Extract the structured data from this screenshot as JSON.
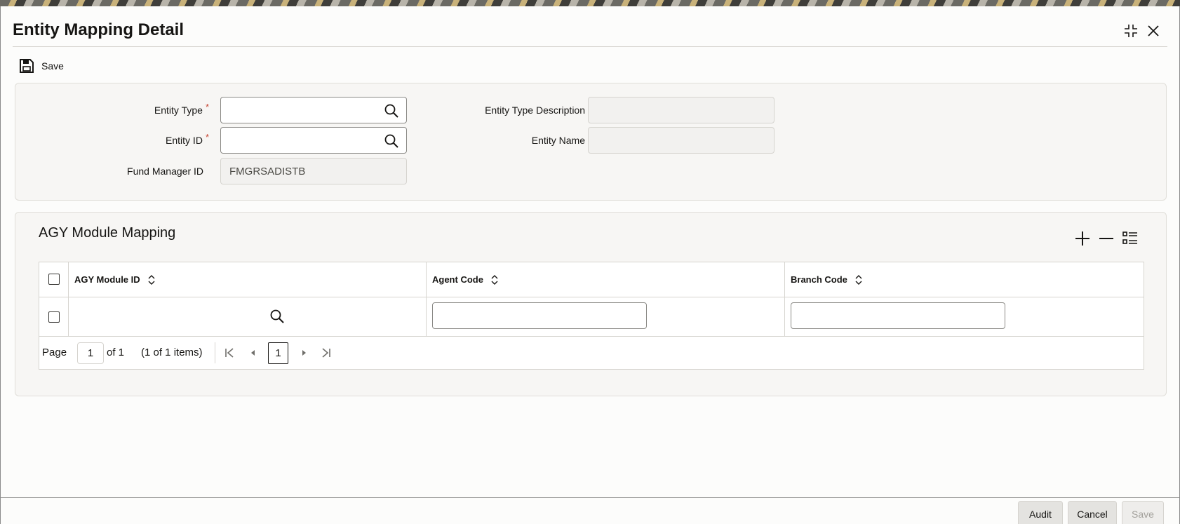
{
  "window": {
    "title": "Entity Mapping Detail"
  },
  "toolbar": {
    "save_label": "Save"
  },
  "form": {
    "entity_type_label": "Entity Type",
    "entity_type_value": "",
    "entity_id_label": "Entity ID",
    "entity_id_value": "",
    "fund_manager_id_label": "Fund Manager ID",
    "fund_manager_id_value": "FMGRSADISTB",
    "entity_type_desc_label": "Entity Type Description",
    "entity_type_desc_value": "",
    "entity_name_label": "Entity Name",
    "entity_name_value": "",
    "required_marker": "*"
  },
  "agy_section": {
    "title": "AGY Module Mapping",
    "columns": [
      "AGY Module ID",
      "Agent Code",
      "Branch Code"
    ],
    "rows": [
      {
        "agy_module_id": "",
        "agent_code": "",
        "branch_code": ""
      }
    ],
    "pager": {
      "page_label": "Page",
      "page_input": "1",
      "of_label": "of 1",
      "items_label": "(1 of 1 items)",
      "current_page": "1"
    }
  },
  "footer": {
    "audit_label": "Audit",
    "cancel_label": "Cancel",
    "save_label": "Save"
  },
  "colors": {
    "required": "#c74634",
    "text": "#161513",
    "border": "#d6d4cf"
  }
}
